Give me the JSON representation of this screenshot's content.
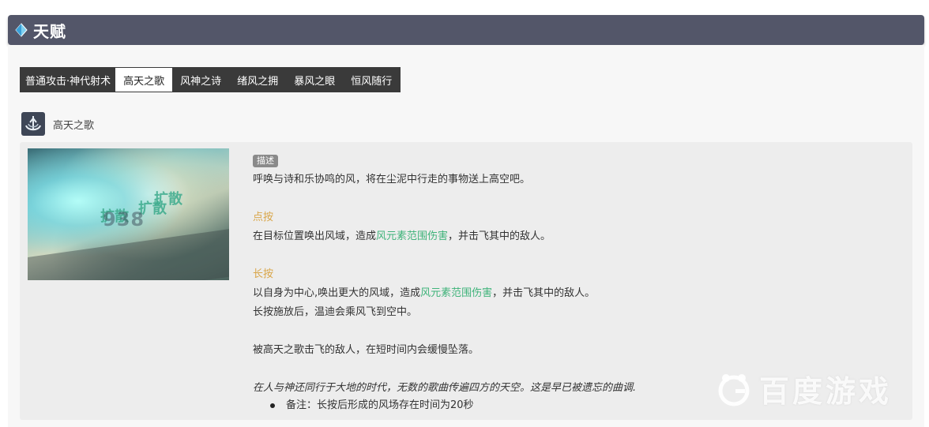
{
  "section": {
    "title": "天赋"
  },
  "tabs": [
    {
      "label": "普通攻击·神代射术",
      "active": false
    },
    {
      "label": "高天之歌",
      "active": true
    },
    {
      "label": "风神之诗",
      "active": false
    },
    {
      "label": "绪风之拥",
      "active": false
    },
    {
      "label": "暴风之眼",
      "active": false
    },
    {
      "label": "恒风随行",
      "active": false
    }
  ],
  "skill": {
    "name": "高天之歌",
    "preview": {
      "fx_text": [
        "扩散",
        "扩散",
        "扩散"
      ],
      "damage_number": "938"
    },
    "desc_badge": "描述",
    "desc_line": "呼唤与诗和乐协鸣的风，将在尘泥中行走的事物送上高空吧。",
    "tap": {
      "label": "点按",
      "before": "在目标位置唤出风域，造成",
      "highlight": "风元素范围伤害",
      "after": "，并击飞其中的敌人。"
    },
    "hold": {
      "label": "长按",
      "before": "以自身为中心,唤出更大的风域，造成",
      "highlight": "风元素范围伤害",
      "after": "，并击飞其中的敌人。",
      "extra": "长按施放后，温迪会乘风飞到空中。"
    },
    "effect_line": "被高天之歌击飞的敌人，在短时间内会缓慢坠落。",
    "flavor": "在人与神还同行于大地的时代，无数的歌曲传遍四方的天空。这是早已被遗忘的曲调.",
    "note": "备注：长按后形成的风场存在时间为20秒"
  },
  "watermark": {
    "text": "百度游戏"
  },
  "colors": {
    "header_bg": "#535669",
    "tab_bg": "#3a3a3a",
    "gold": "#d9a64a",
    "green": "#3fb37a"
  }
}
